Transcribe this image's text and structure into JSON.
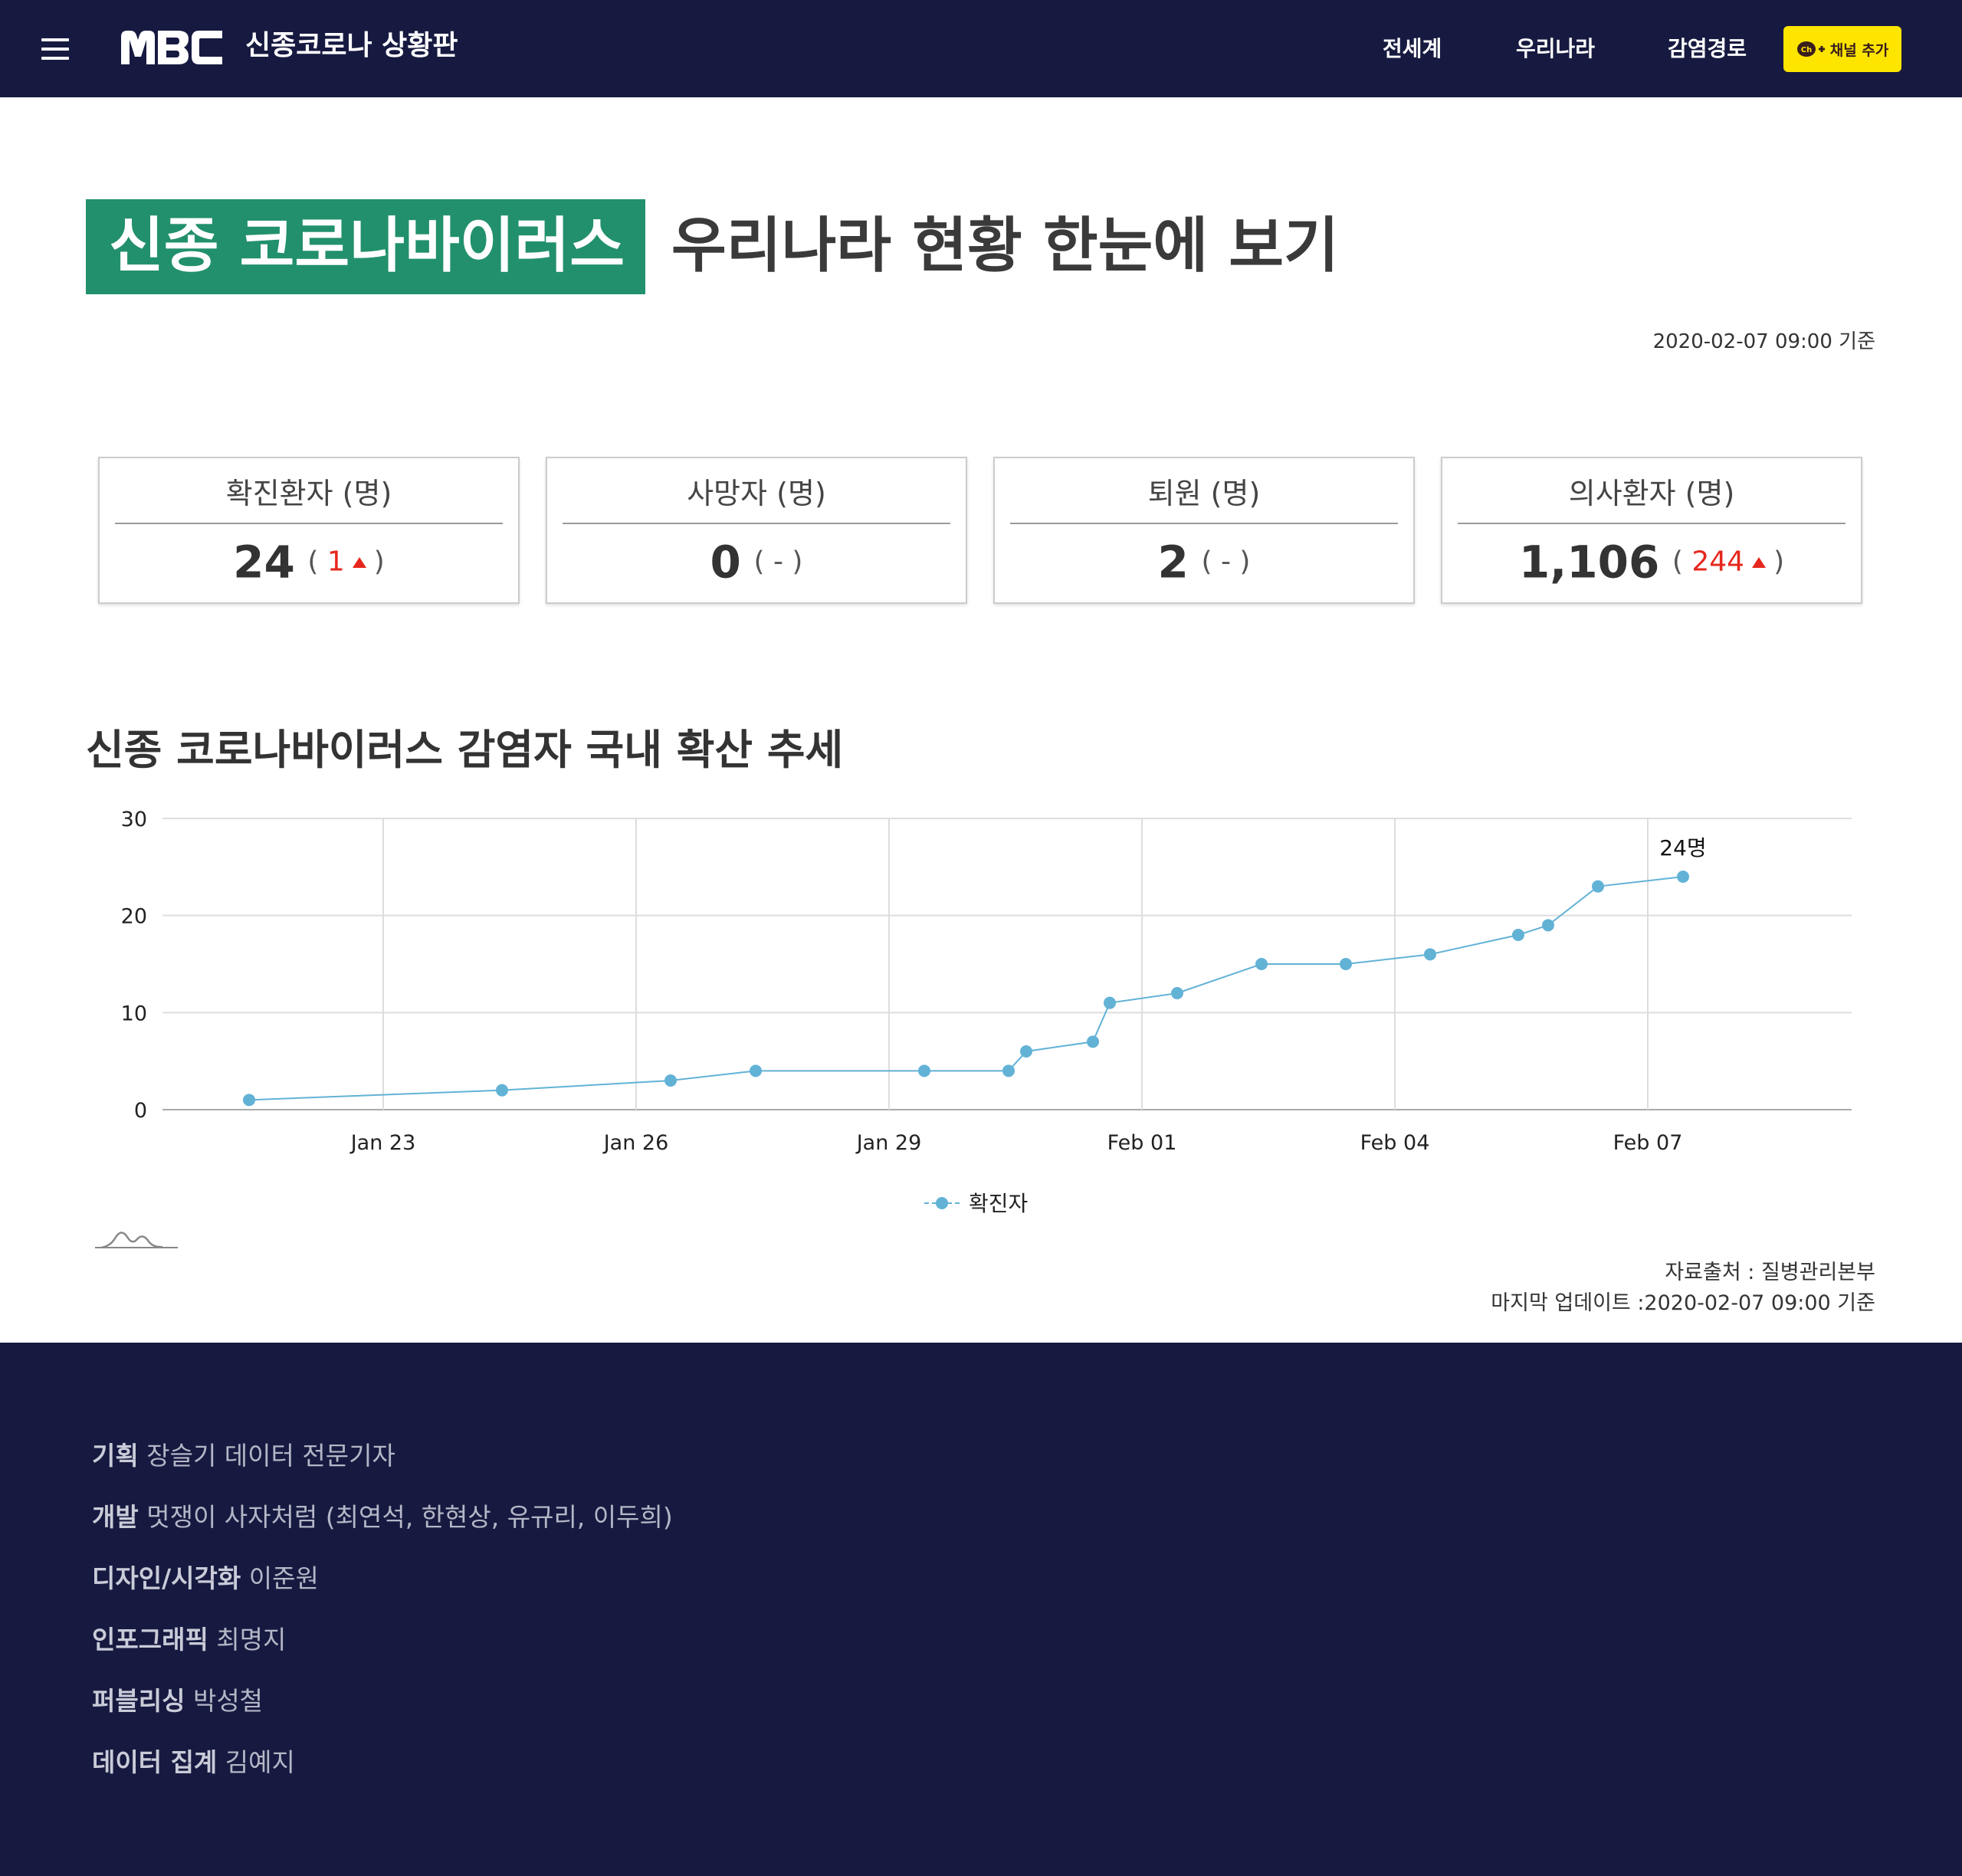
{
  "header": {
    "site_title": "신종코로나 상황판",
    "nav": [
      "전세계",
      "우리나라",
      "감염경로"
    ],
    "kakao_label": "채널 추가"
  },
  "hero": {
    "highlight": "신종 코로나바이러스",
    "rest": "우리나라 현황 한눈에 보기",
    "timestamp": "2020-02-07 09:00 기준"
  },
  "stats": [
    {
      "label": "확진환자 (명)",
      "value": "24",
      "delta": "1",
      "up": true
    },
    {
      "label": "사망자 (명)",
      "value": "0",
      "delta": "-",
      "up": false
    },
    {
      "label": "퇴원 (명)",
      "value": "2",
      "delta": "-",
      "up": false
    },
    {
      "label": "의사환자 (명)",
      "value": "1,106",
      "delta": "244",
      "up": true
    }
  ],
  "chart_section": {
    "title": "신종 코로나바이러스 감염자 국내 확산 추세",
    "source": "자료출처 : 질병관리본부",
    "updated": "마지막 업데이트 :2020-02-07 09:00 기준"
  },
  "chart_data": {
    "type": "line",
    "series": [
      {
        "name": "확진자",
        "color": "#62b2d6",
        "points": [
          {
            "date": "2020-01-20",
            "value": 1
          },
          {
            "date": "2020-01-24",
            "value": 2
          },
          {
            "date": "2020-01-26",
            "value": 3
          },
          {
            "date": "2020-01-27",
            "value": 4
          },
          {
            "date": "2020-01-29",
            "value": 4
          },
          {
            "date": "2020-01-30",
            "value": 4
          },
          {
            "date": "2020-01-30",
            "value": 6
          },
          {
            "date": "2020-01-31",
            "value": 7
          },
          {
            "date": "2020-01-31",
            "value": 11
          },
          {
            "date": "2020-02-01",
            "value": 12
          },
          {
            "date": "2020-02-02",
            "value": 15
          },
          {
            "date": "2020-02-03",
            "value": 15
          },
          {
            "date": "2020-02-04",
            "value": 16
          },
          {
            "date": "2020-02-05",
            "value": 18
          },
          {
            "date": "2020-02-05",
            "value": 19
          },
          {
            "date": "2020-02-06",
            "value": 23
          },
          {
            "date": "2020-02-07",
            "value": 24
          }
        ]
      }
    ],
    "x_ticks": [
      "Jan 23",
      "Jan 26",
      "Jan 29",
      "Feb 01",
      "Feb 04",
      "Feb 07"
    ],
    "y_ticks": [
      0,
      10,
      20,
      30
    ],
    "ylim": [
      0,
      30
    ],
    "last_label": "24명",
    "grid": true,
    "legend": "bottom-center"
  },
  "credits": [
    {
      "role": "기획",
      "names": "장슬기 데이터 전문기자"
    },
    {
      "role": "개발",
      "names": "멋쟁이 사자처럼 (최연석, 한현상, 유규리, 이두희)"
    },
    {
      "role": "디자인/시각화",
      "names": "이준원"
    },
    {
      "role": "인포그래픽",
      "names": "최명지"
    },
    {
      "role": "퍼블리싱",
      "names": "박성철"
    },
    {
      "role": "데이터 집계",
      "names": "김예지"
    }
  ]
}
